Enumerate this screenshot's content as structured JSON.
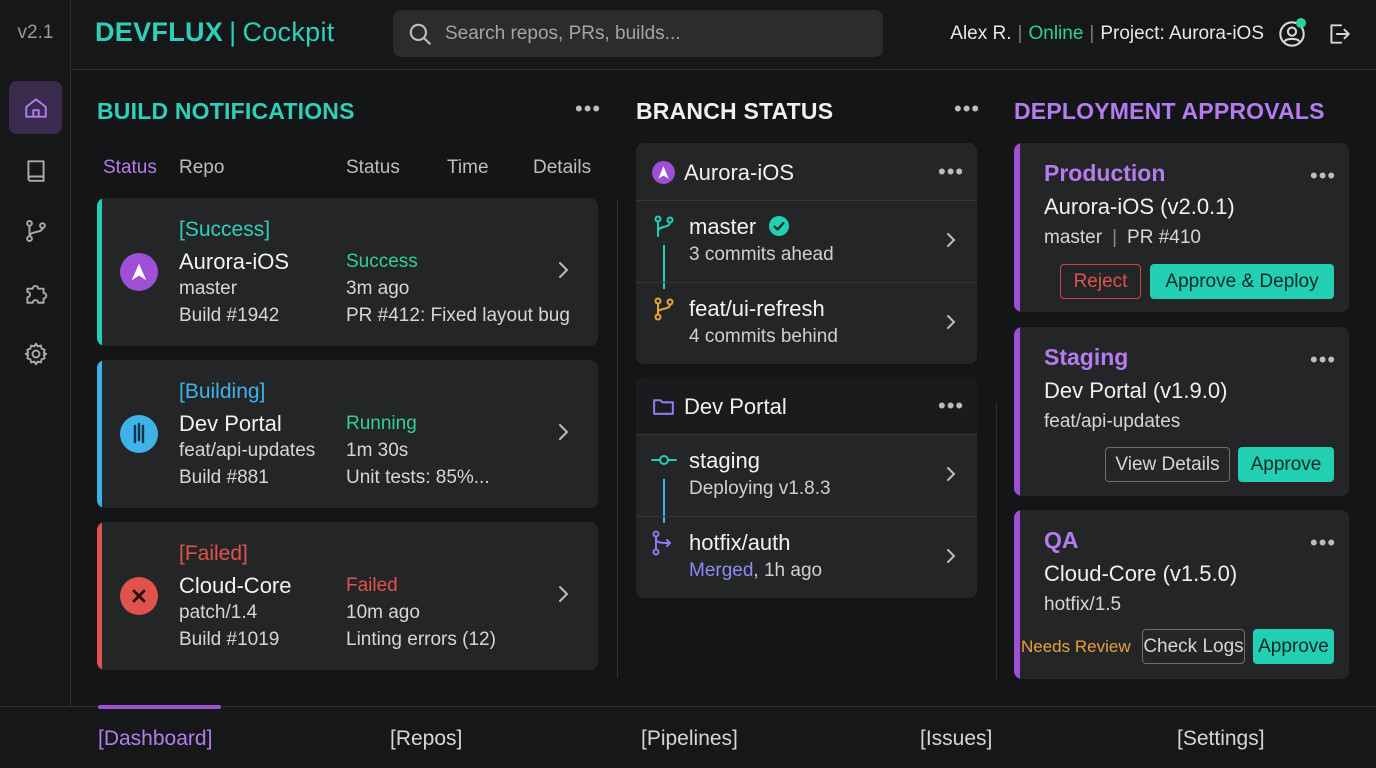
{
  "sidebar": {
    "version": "v2.1",
    "items": [
      {
        "icon": "home-icon",
        "active": true
      },
      {
        "icon": "book-icon",
        "active": false
      },
      {
        "icon": "git-branch-icon",
        "active": false
      },
      {
        "icon": "puzzle-icon",
        "active": false
      },
      {
        "icon": "gear-icon",
        "active": false
      }
    ]
  },
  "header": {
    "brand_name": "DEVFLUX",
    "brand_separator": "|",
    "brand_product": "Cockpit",
    "search_placeholder": "Search repos, PRs, builds...",
    "user_name": "Alex R.",
    "separator": "|",
    "user_status": "Online",
    "project": "Project: Aurora-iOS"
  },
  "build_notifications": {
    "title": "BUILD NOTIFICATIONS",
    "columns": [
      "Status",
      "Repo",
      "Status",
      "Time",
      "Details"
    ],
    "items": [
      {
        "tag": "[Success]",
        "repo": "Aurora-iOS",
        "branch": "master",
        "build": "Build #1942",
        "status": "Success",
        "time": "3m ago",
        "details": "PR #412: Fixed layout bug"
      },
      {
        "tag": "[Building]",
        "repo": "Dev Portal",
        "branch": "feat/api-updates",
        "build": "Build #881",
        "status": "Running",
        "time": "1m 30s",
        "details": "Unit tests: 85%..."
      },
      {
        "tag": "[Failed]",
        "repo": "Cloud-Core",
        "branch": "patch/1.4",
        "build": "Build #1019",
        "status": "Failed",
        "time": "10m ago",
        "details": "Linting errors (12)"
      }
    ]
  },
  "branch_status": {
    "title": "BRANCH STATUS",
    "repos": [
      {
        "name": "Aurora-iOS",
        "branches": [
          {
            "name": "master",
            "sub": "3 commits ahead"
          },
          {
            "name": "feat/ui-refresh",
            "sub": "4 commits behind"
          }
        ]
      },
      {
        "name": "Dev Portal",
        "branches": [
          {
            "name": "staging",
            "sub": "Deploying v1.8.3"
          },
          {
            "name": "hotfix/auth",
            "sub_highlight": "Merged",
            "sub": ", 1h ago"
          }
        ]
      }
    ]
  },
  "deployment_approvals": {
    "title": "DEPLOYMENT APPROVALS",
    "items": [
      {
        "env": "Production",
        "app": "Aurora-iOS (v2.0.1)",
        "meta": "master",
        "meta_sep": "|",
        "meta2": "PR #410",
        "reject": "Reject",
        "approve": "Approve & Deploy"
      },
      {
        "env": "Staging",
        "app": "Dev Portal (v1.9.0)",
        "meta": "feat/api-updates",
        "view": "View Details",
        "approve": "Approve"
      },
      {
        "env": "QA",
        "app": "Cloud-Core (v1.5.0)",
        "meta": "hotfix/1.5",
        "review": "Needs Review",
        "logs": "Check Logs",
        "approve": "Approve"
      }
    ]
  },
  "bottom_nav": {
    "items": [
      "[Dashboard]",
      "[Repos]",
      "[Pipelines]",
      "[Issues]",
      "[Settings]"
    ],
    "active": "[Dashboard]"
  },
  "colors": {
    "teal": "#2fd0bb",
    "purple": "#b57cf0",
    "success": "#2ed19a",
    "building": "#3fb3e8",
    "failed": "#e0524c",
    "warning": "#e8a23a"
  }
}
